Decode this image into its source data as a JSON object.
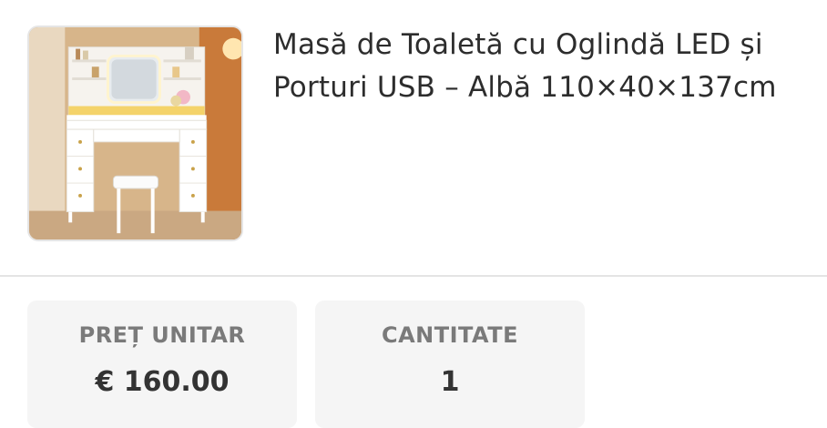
{
  "product": {
    "title": "Masă de Toaletă cu Oglindă LED și Porturi USB – Albă 110×40×137cm",
    "image_icon": "product-photo-vanity-table"
  },
  "unit_price": {
    "label": "PREȚ UNITAR",
    "value": "€ 160.00"
  },
  "quantity": {
    "label": "CANTITATE",
    "value": "1"
  }
}
